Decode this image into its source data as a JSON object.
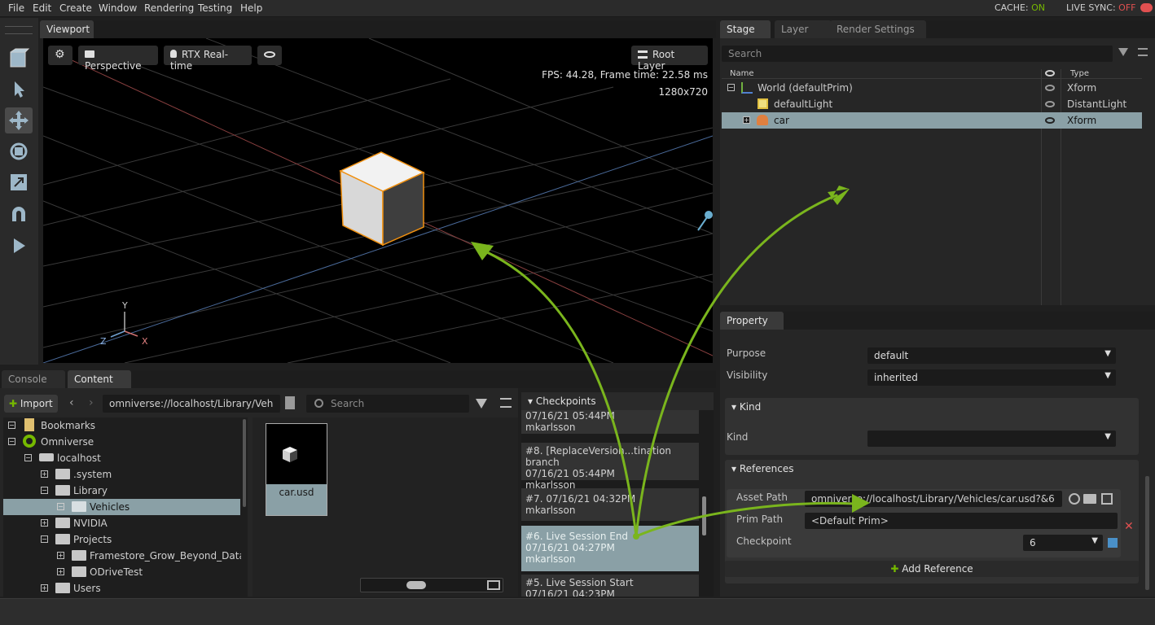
{
  "menu": [
    "File",
    "Edit",
    "Create",
    "Window",
    "Rendering",
    "Testing",
    "Help"
  ],
  "status": {
    "cache_label": "CACHE:",
    "cache_value": "ON",
    "livesync_label": "LIVE SYNC:",
    "livesync_value": "OFF"
  },
  "viewport": {
    "tab": "Viewport",
    "camera": "Perspective",
    "renderer": "RTX Real-time",
    "layer": "Root Layer",
    "fps": "FPS: 44.28, Frame time: 22.58 ms",
    "resolution": "1280x720",
    "axes": {
      "y": "Y",
      "z": "Z",
      "x": "X"
    }
  },
  "stage": {
    "tabs": [
      "Stage",
      "Layer",
      "Render Settings"
    ],
    "search_placeholder": "Search",
    "col_name": "Name",
    "col_type": "Type",
    "rows": [
      {
        "name": "World (defaultPrim)",
        "type": "Xform"
      },
      {
        "name": "defaultLight",
        "type": "DistantLight"
      },
      {
        "name": "car",
        "type": "Xform"
      }
    ]
  },
  "property": {
    "tab": "Property",
    "purpose_label": "Purpose",
    "purpose_value": "default",
    "visibility_label": "Visibility",
    "visibility_value": "inherited",
    "kind_section": "Kind",
    "kind_label": "Kind",
    "kind_value": "",
    "references_section": "References",
    "asset_path_label": "Asset Path",
    "asset_path_value": "omniverse://localhost/Library/Vehicles/car.usd?&6",
    "prim_path_label": "Prim Path",
    "prim_path_value": "<Default Prim>",
    "checkpoint_label": "Checkpoint",
    "checkpoint_value": "6",
    "add_reference": "Add Reference"
  },
  "bottom_tabs": [
    "Console",
    "Content"
  ],
  "content": {
    "import_label": "Import",
    "path": "omniverse://localhost/Library/Veh",
    "search_placeholder": "Search",
    "tree": [
      {
        "label": "Bookmarks"
      },
      {
        "label": "Omniverse"
      },
      {
        "label": "localhost"
      },
      {
        "label": ".system"
      },
      {
        "label": "Library"
      },
      {
        "label": "Vehicles"
      },
      {
        "label": "NVIDIA"
      },
      {
        "label": "Projects"
      },
      {
        "label": "Framestore_Grow_Beyond_Dataset"
      },
      {
        "label": "ODriveTest"
      },
      {
        "label": "Users"
      }
    ],
    "file": "car.usd"
  },
  "checkpoints": {
    "title": "Checkpoints",
    "items": [
      {
        "line1": "07/16/21 05:44PM",
        "line2": "mkarlsson"
      },
      {
        "line0": "#8.   [ReplaceVersion...tination branch",
        "line1": "07/16/21 05:44PM",
        "line2": "mkarlsson"
      },
      {
        "line0": "#7.   07/16/21 04:32PM",
        "line2": "mkarlsson"
      },
      {
        "line0": "#6.   Live Session End",
        "line1": "07/16/21 04:27PM",
        "line2": "mkarlsson"
      },
      {
        "line0": "#5.   Live Session Start",
        "line1": "07/16/21 04:23PM"
      }
    ]
  },
  "colors": {
    "accent": "#76b900",
    "selection": "#8aa0a6",
    "off": "#e05050"
  }
}
